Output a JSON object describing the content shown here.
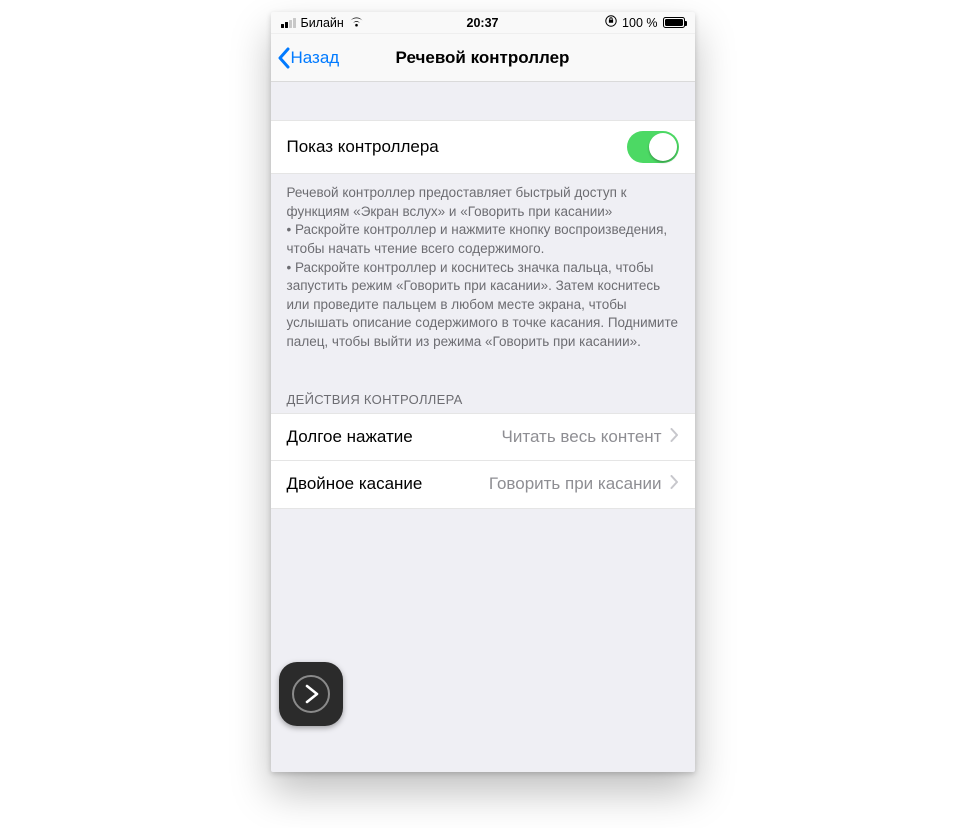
{
  "statusbar": {
    "carrier": "Билайн",
    "time": "20:37",
    "battery_text": "100 %"
  },
  "navbar": {
    "back_label": "Назад",
    "title": "Речевой контроллер"
  },
  "show_controller": {
    "label": "Показ контроллера",
    "on": true
  },
  "description": "Речевой контроллер предоставляет быстрый доступ к функциям «Экран вслух» и «Говорить при касании»\n • Раскройте контроллер и нажмите кнопку воспроизведения, чтобы начать чтение всего содержимого.\n • Раскройте контроллер и коснитесь значка пальца, чтобы запустить режим «Говорить при касании». Затем коснитесь или проведите пальцем в любом месте экрана, чтобы услышать описание содержимого в точке касания. Поднимите палец, чтобы выйти из режима «Говорить при касании».",
  "actions_header": "ДЕЙСТВИЯ КОНТРОЛЛЕРА",
  "actions": [
    {
      "label": "Долгое нажатие",
      "value": "Читать весь контент"
    },
    {
      "label": "Двойное касание",
      "value": "Говорить при касании"
    }
  ]
}
